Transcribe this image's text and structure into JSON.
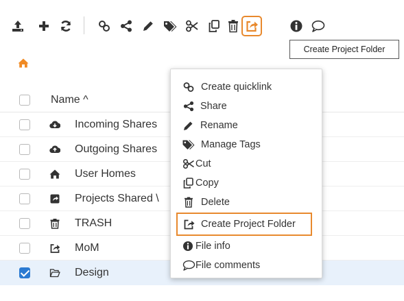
{
  "toolbar": {
    "buttons": [
      {
        "name": "upload-icon"
      },
      {
        "name": "plus-icon"
      },
      {
        "name": "refresh-icon"
      },
      {
        "name": "quicklink-icon"
      },
      {
        "name": "share-icon"
      },
      {
        "name": "pencil-icon"
      },
      {
        "name": "tags-icon"
      },
      {
        "name": "scissors-icon"
      },
      {
        "name": "copy-icon"
      },
      {
        "name": "trash-icon"
      },
      {
        "name": "create-project-folder-icon"
      },
      {
        "name": "info-icon"
      },
      {
        "name": "comment-icon"
      }
    ],
    "tooltip": "Create Project Folder"
  },
  "breadcrumb": {
    "icon": "home-icon"
  },
  "table": {
    "header": {
      "name": "Name ^"
    },
    "rows": [
      {
        "icon": "cloud-download-icon",
        "name": "Incoming Shares",
        "checked": false
      },
      {
        "icon": "cloud-upload-icon",
        "name": "Outgoing Shares",
        "checked": false
      },
      {
        "icon": "home-icon",
        "name": "User Homes",
        "checked": false
      },
      {
        "icon": "shared-folder-icon",
        "name": "Projects Shared \\",
        "checked": false
      },
      {
        "icon": "trash-icon",
        "name": "TRASH",
        "checked": false
      },
      {
        "icon": "project-folder-icon",
        "name": "MoM",
        "checked": false
      },
      {
        "icon": "folder-open-icon",
        "name": "Design",
        "checked": true
      }
    ]
  },
  "context_menu": {
    "items": [
      {
        "icon": "quicklink-icon",
        "label": "Create quicklink"
      },
      {
        "icon": "share-icon",
        "label": "Share"
      },
      {
        "icon": "pencil-icon",
        "label": "Rename"
      },
      {
        "icon": "tags-icon",
        "label": "Manage Tags"
      },
      {
        "icon": "scissors-icon",
        "label": "Cut"
      },
      {
        "icon": "copy-icon",
        "label": "Copy"
      },
      {
        "icon": "trash-icon",
        "label": "Delete"
      },
      {
        "icon": "create-project-folder-icon",
        "label": "Create Project Folder",
        "highlighted": true
      },
      {
        "icon": "info-icon",
        "label": "File info"
      },
      {
        "icon": "comment-icon",
        "label": "File comments"
      }
    ]
  },
  "colors": {
    "accent_highlight": "#e8892d",
    "home_icon": "#f08a24",
    "selected_row": "#e8f1fb",
    "checkbox_checked": "#2a7ad2"
  }
}
